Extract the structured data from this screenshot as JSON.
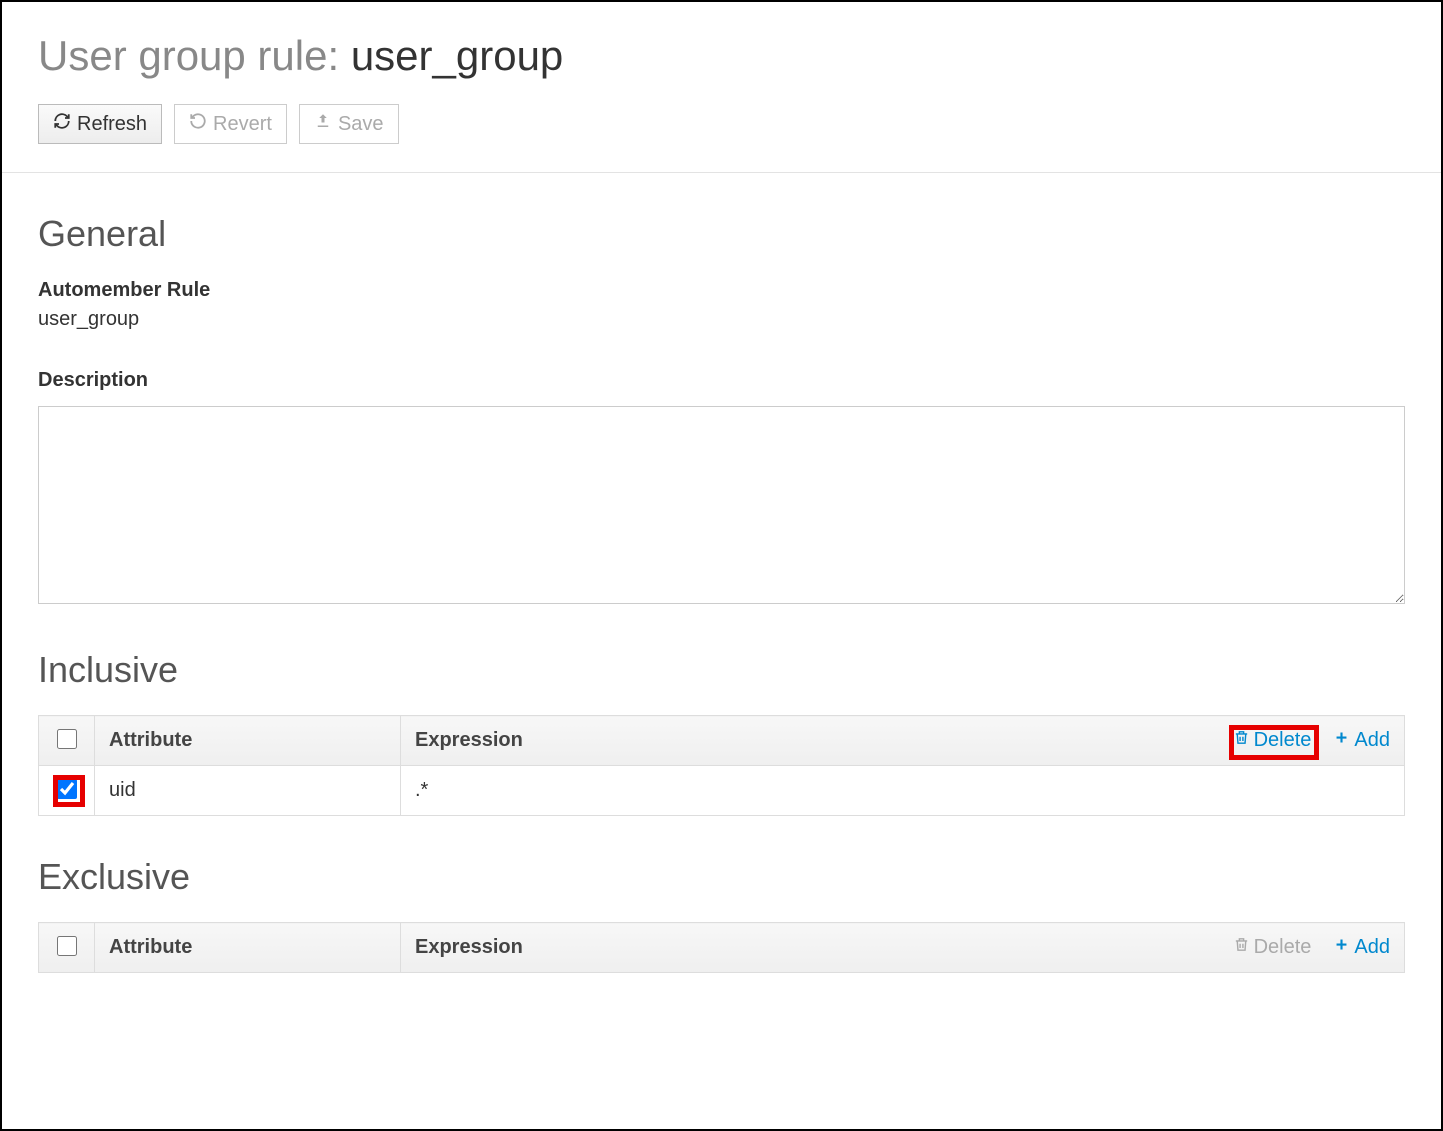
{
  "title": {
    "prefix": "User group rule: ",
    "name": "user_group"
  },
  "toolbar": {
    "refresh": "Refresh",
    "revert": "Revert",
    "save": "Save"
  },
  "sections": {
    "general": "General",
    "inclusive": "Inclusive",
    "exclusive": "Exclusive"
  },
  "general": {
    "rule_label": "Automember Rule",
    "rule_value": "user_group",
    "description_label": "Description",
    "description_value": ""
  },
  "table": {
    "col_attribute": "Attribute",
    "col_expression": "Expression",
    "delete": "Delete",
    "add": "Add"
  },
  "inclusive_rows": [
    {
      "checked": true,
      "attribute": "uid",
      "expression": ".*"
    }
  ],
  "exclusive_rows": []
}
